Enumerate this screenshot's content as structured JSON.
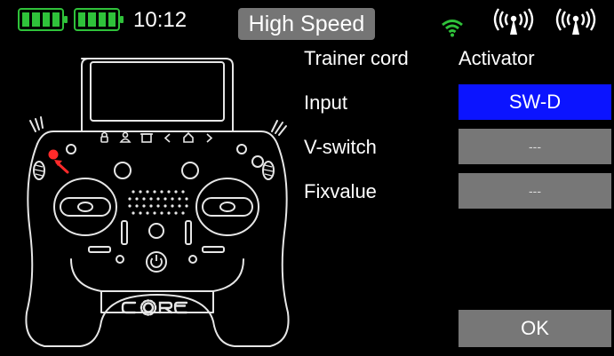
{
  "status_bar": {
    "battery_tx_icon": "battery-full-icon",
    "battery_rx_icon": "battery-full-icon",
    "time": "10:12",
    "mode": "High Speed",
    "wifi_icon": "wifi-icon",
    "antenna_icon_1": "antenna-signal-icon",
    "antenna_icon_2": "antenna-signal-icon"
  },
  "transmitter_illustration": {
    "brand": "CORE",
    "highlighted_switch": "SW-D",
    "highlight_color": "#ff2a2a"
  },
  "trainer": {
    "trainer_cord_label": "Trainer cord",
    "activator_label": "Activator",
    "input_label": "Input",
    "input_value": "SW-D",
    "vswitch_label": "V-switch",
    "vswitch_value": "---",
    "fixvalue_label": "Fixvalue",
    "fixvalue_value": "---",
    "ok_label": "OK"
  },
  "colors": {
    "accent_blue": "#0b14ff",
    "button_gray": "#777777",
    "status_green": "#2fc23a"
  }
}
